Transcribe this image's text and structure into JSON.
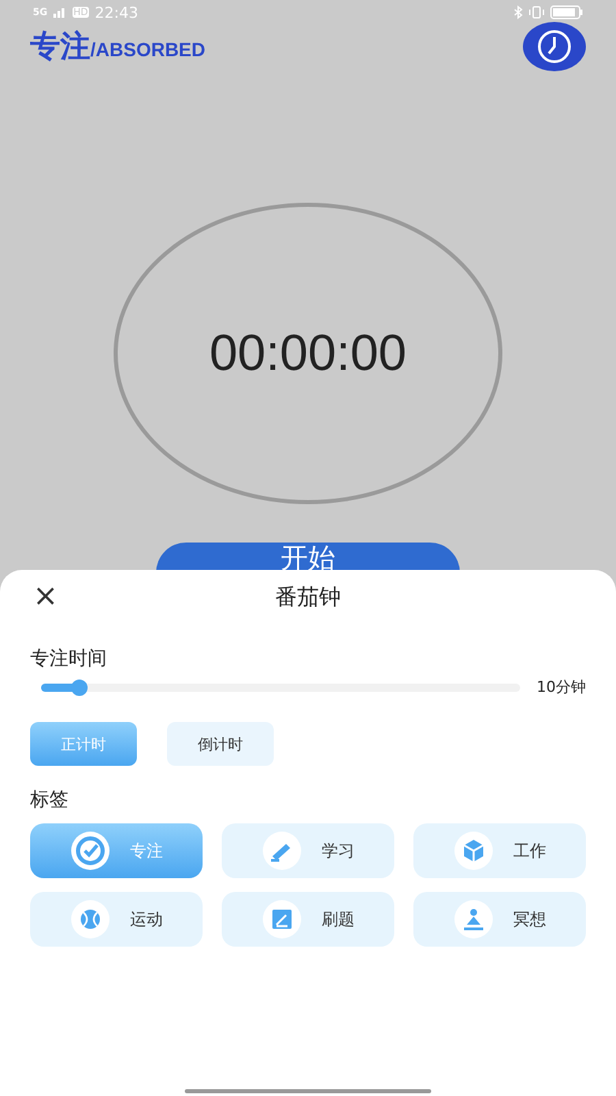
{
  "status_bar": {
    "network": "5G",
    "hd": "HD",
    "time": "22:43"
  },
  "header": {
    "title_cn": "专注",
    "title_en": "/ABSORBED"
  },
  "timer": {
    "display": "00:00:00"
  },
  "start_button": {
    "label": "开始"
  },
  "sheet": {
    "title": "番茄钟",
    "close": "×",
    "duration": {
      "label": "专注时间",
      "level": 0.08,
      "reading": "10分钟"
    },
    "modes": [
      {
        "label": "正计时",
        "selected": true
      },
      {
        "label": "倒计时",
        "selected": false
      }
    ],
    "tags_label": "标签",
    "tags": [
      {
        "label": "专注",
        "kind": "target",
        "selected": true
      },
      {
        "label": "学习",
        "kind": "pencil",
        "selected": false
      },
      {
        "label": "工作",
        "kind": "cube",
        "selected": false
      },
      {
        "label": "运动",
        "kind": "ball",
        "selected": false
      },
      {
        "label": "刷题",
        "kind": "edit",
        "selected": false
      },
      {
        "label": "冥想",
        "kind": "meditate",
        "selected": false
      }
    ]
  }
}
